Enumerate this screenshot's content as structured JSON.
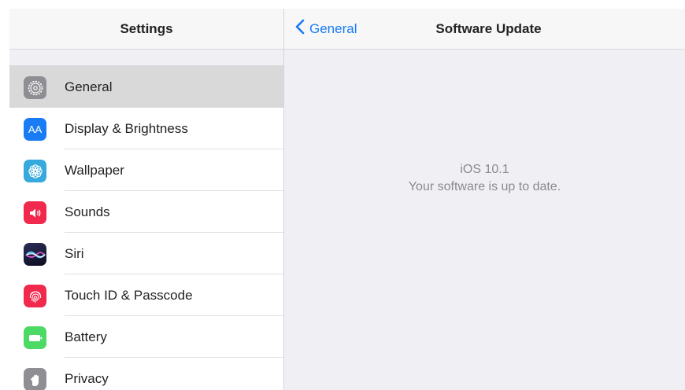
{
  "sidebar": {
    "title": "Settings",
    "items": [
      {
        "label": "General",
        "icon": "gear-icon",
        "color": "#8e8e93",
        "selected": true
      },
      {
        "label": "Display & Brightness",
        "icon": "text-size-icon",
        "color": "#1a7cf5"
      },
      {
        "label": "Wallpaper",
        "icon": "flower-icon",
        "color": "#36aadc"
      },
      {
        "label": "Sounds",
        "icon": "speaker-icon",
        "color": "#f0294d"
      },
      {
        "label": "Siri",
        "icon": "siri-icon",
        "color": "#1b1e3c"
      },
      {
        "label": "Touch ID & Passcode",
        "icon": "fingerprint-icon",
        "color": "#f0294d"
      },
      {
        "label": "Battery",
        "icon": "battery-icon",
        "color": "#4cd964"
      },
      {
        "label": "Privacy",
        "icon": "hand-icon",
        "color": "#8e8e93"
      }
    ],
    "display_icon_text": "AA"
  },
  "detail": {
    "back_label": "General",
    "title": "Software Update",
    "version": "iOS 10.1",
    "message": "Your software is up to date."
  },
  "colors": {
    "accent": "#1a7cf5",
    "background": "#efeff4"
  }
}
